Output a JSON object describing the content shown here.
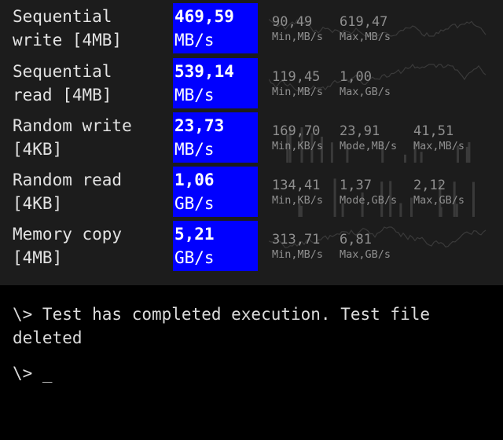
{
  "tests": [
    {
      "label_line1": "Sequential",
      "label_line2": "write [4MB]",
      "value": "469,59",
      "unit": "MB/s",
      "stats": [
        {
          "value": "90,49",
          "caption": "Min,MB/s"
        },
        {
          "value": "619,47",
          "caption": "Max,MB/s"
        }
      ]
    },
    {
      "label_line1": "Sequential",
      "label_line2": "read [4MB]",
      "value": "539,14",
      "unit": "MB/s",
      "stats": [
        {
          "value": "119,45",
          "caption": "Min,MB/s"
        },
        {
          "value": "1,00",
          "caption": "Max,GB/s"
        }
      ]
    },
    {
      "label_line1": "Random write",
      "label_line2": "[4KB]",
      "value": "23,73",
      "unit": "MB/s",
      "stats": [
        {
          "value": "169,70",
          "caption": "Min,KB/s"
        },
        {
          "value": "23,91",
          "caption": "Mode,MB/s"
        },
        {
          "value": "41,51",
          "caption": "Max,MB/s"
        }
      ]
    },
    {
      "label_line1": "Random read",
      "label_line2": "[4KB]",
      "value": "1,06",
      "unit": "GB/s",
      "stats": [
        {
          "value": "134,41",
          "caption": "Min,KB/s"
        },
        {
          "value": "1,37",
          "caption": "Mode,GB/s"
        },
        {
          "value": "2,12",
          "caption": "Max,GB/s"
        }
      ]
    },
    {
      "label_line1": "Memory copy",
      "label_line2": "[4MB]",
      "value": "5,21",
      "unit": "GB/s",
      "stats": [
        {
          "value": "313,71",
          "caption": "Min,MB/s"
        },
        {
          "value": "6,81",
          "caption": "Max,GB/s"
        }
      ]
    }
  ],
  "console": {
    "message": "\\> Test has completed execution. Test file deleted",
    "prompt": "\\> _"
  },
  "colors": {
    "panel_background": "#1c1c1c",
    "console_background": "#000000",
    "result_background": "#0000ff",
    "result_text": "#ffffff",
    "stat_text": "#8f8f8f",
    "sparkline": "#3a3a3a"
  }
}
